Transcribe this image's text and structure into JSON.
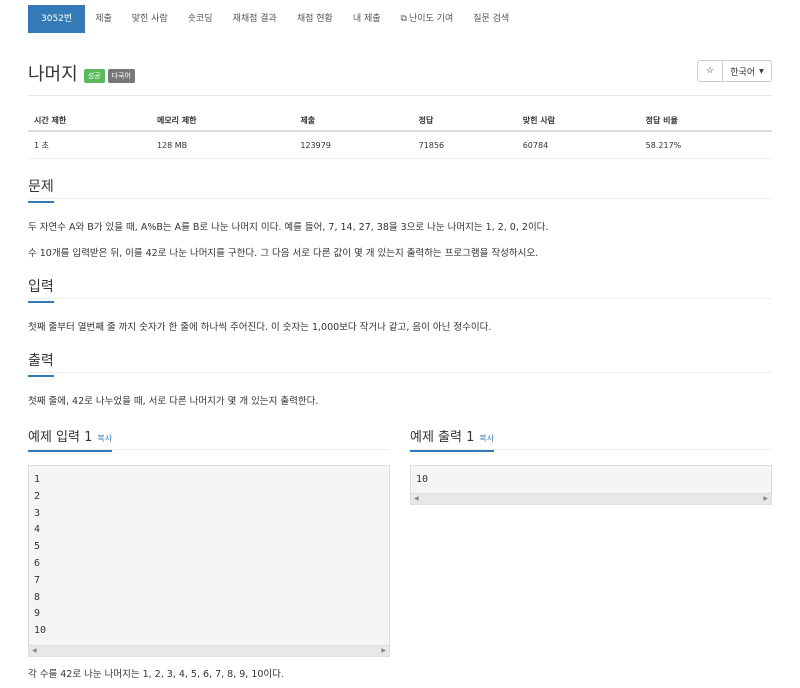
{
  "nav": {
    "items": [
      {
        "label": "3052번",
        "active": true
      },
      {
        "label": "제출"
      },
      {
        "label": "맞힌 사람"
      },
      {
        "label": "숏코딩"
      },
      {
        "label": "재채점 결과"
      },
      {
        "label": "채점 현황"
      },
      {
        "label": "내 제출"
      },
      {
        "label": "난이도 기여",
        "icon": "external-link-icon"
      },
      {
        "label": "질문 검색"
      }
    ]
  },
  "problem": {
    "title": "나머지",
    "badges": [
      "성공",
      "다국어"
    ],
    "star": "☆",
    "language": "한국어"
  },
  "info_table": {
    "headers": [
      "시간 제한",
      "메모리 제한",
      "제출",
      "정답",
      "맞힌 사람",
      "정답 비율"
    ],
    "row": [
      "1 초",
      "128 MB",
      "123979",
      "71856",
      "60784",
      "58.217%"
    ]
  },
  "sections": {
    "problem_heading": "문제",
    "problem_p1": "두 자연수 A와 B가 있을 때, A%B는 A를 B로 나눈 나머지 이다. 예를 들어, 7, 14, 27, 38을 3으로 나눈 나머지는 1, 2, 0, 2이다.",
    "problem_p2": "수 10개를 입력받은 뒤, 이를 42로 나눈 나머지를 구한다. 그 다음 서로 다른 값이 몇 개 있는지 출력하는 프로그램을 작성하시오.",
    "input_heading": "입력",
    "input_p": "첫째 줄부터 열번째 줄 까지 숫자가 한 줄에 하나씩 주어진다. 이 숫자는 1,000보다 작거나 같고, 음이 아닌 정수이다.",
    "output_heading": "출력",
    "output_p": "첫째 줄에, 42로 나누었을 때, 서로 다른 나머지가 몇 개 있는지 출력한다."
  },
  "samples": {
    "input_heading": "예제 입력 1",
    "output_heading": "예제 출력 1",
    "copy_label": "복사",
    "input_text": "1\n2\n3\n4\n5\n6\n7\n8\n9\n10",
    "output_text": "10",
    "note": "각 수를 42로 나눈 나머지는 1, 2, 3, 4, 5, 6, 7, 8, 9, 10이다."
  }
}
